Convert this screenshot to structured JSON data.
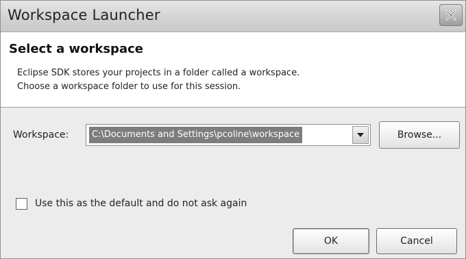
{
  "window": {
    "title": "Workspace Launcher",
    "close_icon": "close-icon"
  },
  "header": {
    "title": "Select a workspace",
    "description_line1": "Eclipse SDK stores your projects in a folder called a workspace.",
    "description_line2": "Choose a workspace folder to use for this session."
  },
  "workspace": {
    "label": "Workspace:",
    "value": "C:\\Documents and Settings\\pcoline\\workspace",
    "dropdown_icon": "chevron-down-icon",
    "browse_label": "Browse..."
  },
  "default_checkbox": {
    "label": "Use this as the default and do not ask again",
    "checked": false
  },
  "buttons": {
    "ok_label": "OK",
    "cancel_label": "Cancel"
  }
}
